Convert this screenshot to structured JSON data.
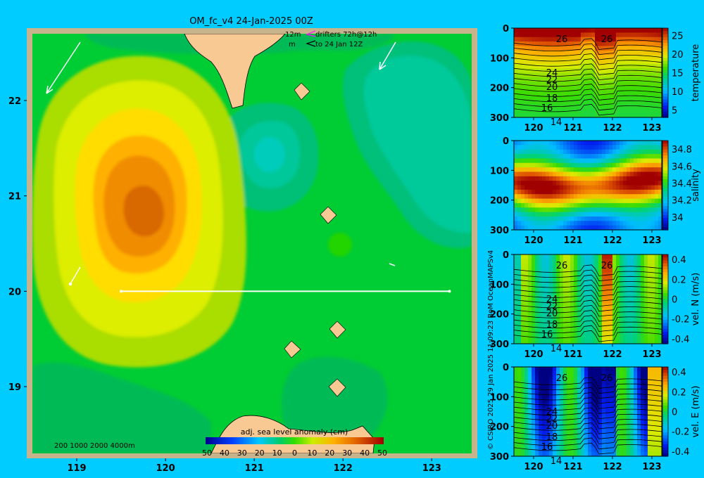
{
  "title": "OM_fc_v4  24-Jan-2025 00Z",
  "drifter_legend": {
    "line1": "12m",
    "line2": "m",
    "text1": "drifters 72h@12h",
    "text2": "to 24 Jan 12Z"
  },
  "depth_legend": "200  1000  2000  4000m",
  "side_credit": "© CSIRO 2025   29 Jan 2025 11:09:23 BoM OceanMAPSv4",
  "colors": {
    "background": "#00CCFF",
    "land": "#F9C994",
    "frame": "#C8B48C"
  },
  "chart_data": [
    {
      "type": "heatmap",
      "name": "map",
      "colorbar_title": "adj. sea level anomaly (cm)",
      "colorbar_ticks": [
        "50",
        "40",
        "30",
        "20",
        "10",
        "0",
        "10",
        "20",
        "30",
        "40",
        "50"
      ],
      "xticks": [
        "119",
        "120",
        "121",
        "122",
        "123"
      ],
      "yticks": [
        "22",
        "21",
        "20",
        "19"
      ],
      "xlim": [
        118.5,
        123.45
      ],
      "ylim": [
        18.3,
        22.7
      ],
      "section_line": {
        "lat": 20.0,
        "lon_start": 119.5,
        "lon_end": 123.2
      },
      "anomaly_centers": [
        {
          "lon": 119.8,
          "lat": 20.8,
          "value": 35
        },
        {
          "lon": 121.2,
          "lat": 21.15,
          "value": -12
        },
        {
          "lon": 122.6,
          "lat": 21.6,
          "value": -9
        },
        {
          "lon": 122.9,
          "lat": 20.7,
          "value": -8
        }
      ]
    },
    {
      "type": "heatmap",
      "name": "temperature",
      "label": "temperature",
      "xticks": [
        "120",
        "121",
        "122",
        "123"
      ],
      "yticks": [
        "0",
        "100",
        "200",
        "300"
      ],
      "cbar_ticks": [
        "25",
        "20",
        "15",
        "10",
        "5"
      ],
      "vmin": 3,
      "vmax": 27,
      "contour_labels": [
        "26",
        "26",
        "24",
        "22",
        "20",
        "18",
        "16",
        "14"
      ]
    },
    {
      "type": "heatmap",
      "name": "salinity",
      "label": "salinity",
      "xticks": [
        "120",
        "121",
        "122",
        "123"
      ],
      "yticks": [
        "0",
        "100",
        "200",
        "300"
      ],
      "cbar_ticks": [
        "34.8",
        "34.6",
        "34.4",
        "34.2",
        "34"
      ],
      "vmin": 33.85,
      "vmax": 34.9
    },
    {
      "type": "heatmap",
      "name": "vel-n",
      "label": "vel. N (m/s)",
      "xticks": [
        "120",
        "121",
        "122",
        "123"
      ],
      "yticks": [
        "0",
        "100",
        "200",
        "300"
      ],
      "cbar_ticks": [
        "0.4",
        "0.2",
        "0",
        "-0.2",
        "-0.4"
      ],
      "vmin": -0.45,
      "vmax": 0.45,
      "contour_labels": [
        "26",
        "26",
        "24",
        "22",
        "20",
        "18",
        "16",
        "14"
      ]
    },
    {
      "type": "heatmap",
      "name": "vel-e",
      "label": "vel. E (m/s)",
      "xticks": [
        "120",
        "121",
        "122",
        "123"
      ],
      "yticks": [
        "0",
        "100",
        "200",
        "300"
      ],
      "cbar_ticks": [
        "0.4",
        "0.2",
        "0",
        "-0.2",
        "-0.4"
      ],
      "vmin": -0.45,
      "vmax": 0.45,
      "contour_labels": [
        "26",
        "26",
        "24",
        "22",
        "20",
        "18",
        "16",
        "14"
      ]
    }
  ]
}
